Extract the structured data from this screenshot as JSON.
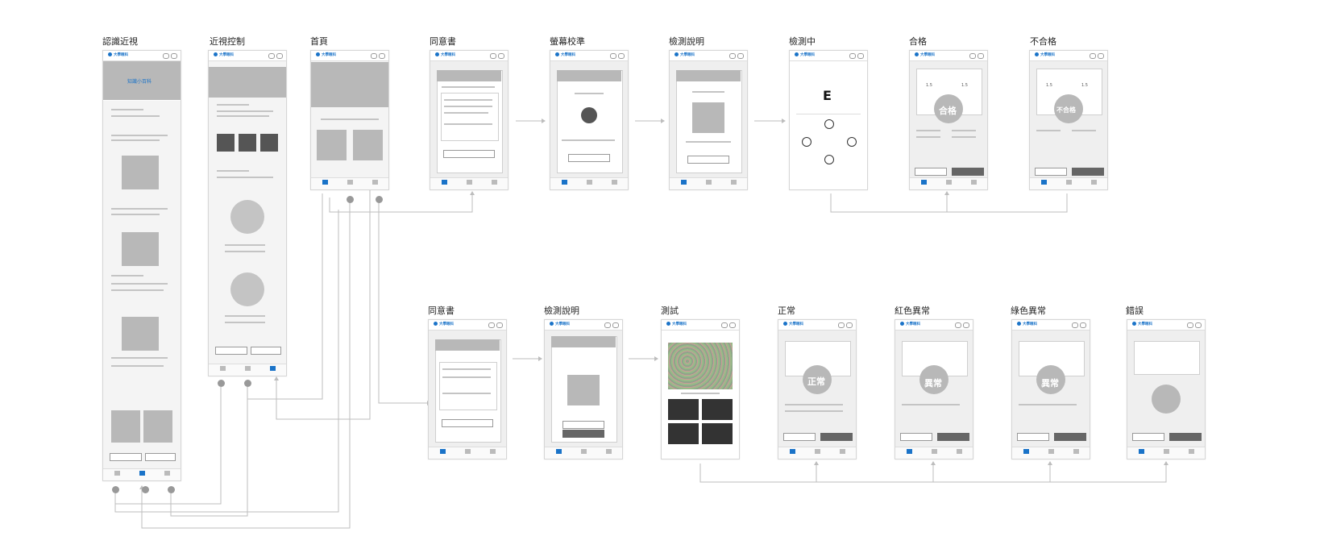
{
  "labels": {
    "row1": [
      "認識近視",
      "近視控制",
      "首頁",
      "同意書",
      "螢幕校準",
      "檢測說明",
      "檢測中",
      "合格",
      "不合格"
    ],
    "row2": [
      "同意書",
      "檢測說明",
      "測試",
      "正常",
      "紅色異常",
      "綠色異常",
      "錯誤"
    ]
  },
  "brand": "大學眼科",
  "screens": {
    "know_title": "知識小百科",
    "eye_letter": "E",
    "pass_stamp": "合格",
    "fail_stamp": "不合格",
    "normal_stamp": "正常",
    "red_stamp": "異常",
    "green_stamp": "異常",
    "pass_val_left": "1.5",
    "pass_val_right": "1.5",
    "fail_val_left": "1.5",
    "fail_val_right": "1.5"
  },
  "colors": {
    "accent": "#1a73c8",
    "placeholder": "#b8b8b8",
    "connector": "#bdbdbd"
  }
}
